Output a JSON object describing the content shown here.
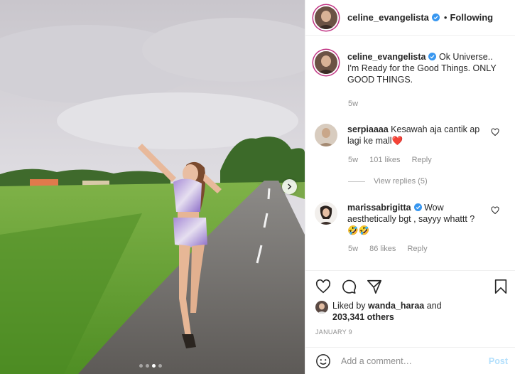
{
  "post": {
    "author": "celine_evangelista",
    "bullet": "•",
    "follow_status": "Following",
    "caption_author": "celine_evangelista",
    "caption_text": "Ok Universe.. I'm Ready for the Good Things. ONLY GOOD THINGS.",
    "caption_age": "5w",
    "date": "JANUARY 9",
    "carousel_count": 4,
    "carousel_active": 3
  },
  "comments": [
    {
      "user": "serpiaaaa",
      "text": "Kesawah aja cantik ap lagi ke mall",
      "emoji": "❤️",
      "age": "5w",
      "likes": "101 likes",
      "reply": "Reply",
      "view_replies": "View replies (5)"
    },
    {
      "user": "marissabrigitta",
      "text": "Wow aesthetically bgt , sayyy whattt ?",
      "emoji": "🤣🤣",
      "age": "5w",
      "likes": "86 likes",
      "reply": "Reply"
    }
  ],
  "likes": {
    "prefix": "Liked by",
    "user": "wanda_haraa",
    "joiner": "and",
    "others": "203,341 others"
  },
  "add_comment": {
    "placeholder": "Add a comment…",
    "post_label": "Post"
  },
  "colors": {
    "verified": "#3897f0",
    "post_button_disabled": "#b2dffc",
    "heart_red": "#ed4956"
  },
  "icons": [
    "heart-icon",
    "comment-icon",
    "share-icon",
    "bookmark-icon",
    "verified-icon",
    "chevron-right-icon"
  ]
}
